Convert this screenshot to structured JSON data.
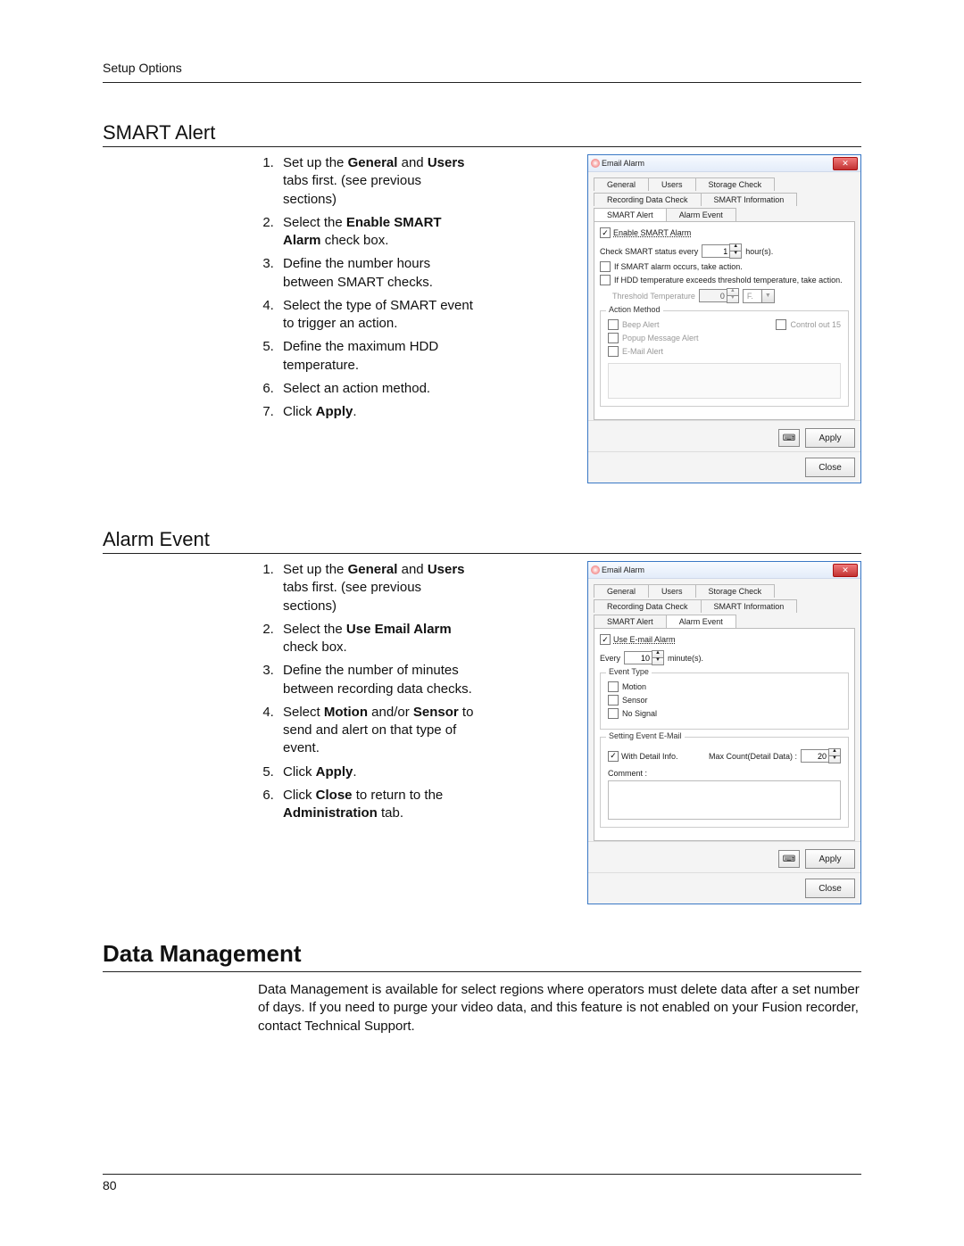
{
  "header": {
    "label": "Setup Options"
  },
  "footer": {
    "page_number": "80"
  },
  "sections": {
    "smart_alert": {
      "title": "SMART Alert",
      "steps": {
        "s1": {
          "pre": "Set up the ",
          "b1": "General",
          "mid": " and ",
          "b2": "Users",
          "post": " tabs first. (see previous sections)"
        },
        "s2": {
          "pre": "Select the ",
          "b1": "Enable SMART Alarm",
          "post": " check box."
        },
        "s3": "Define the number hours between SMART checks.",
        "s4": "Select the type of SMART event to trigger an action.",
        "s5": "Define the maximum HDD temperature.",
        "s6": "Select an action method.",
        "s7": {
          "pre": "Click ",
          "b1": "Apply",
          "post": "."
        }
      }
    },
    "alarm_event": {
      "title": "Alarm Event",
      "steps": {
        "s1": {
          "pre": "Set up the ",
          "b1": "General",
          "mid": " and ",
          "b2": "Users",
          "post": " tabs first. (see previous sections)"
        },
        "s2": {
          "pre": "Select the ",
          "b1": "Use Email Alarm",
          "post": " check box."
        },
        "s3": "Define the number of minutes between recording data checks.",
        "s4": {
          "pre": "Select ",
          "b1": "Motion",
          "mid": " and/or ",
          "b2": "Sensor",
          "post": " to send and alert on that type of event."
        },
        "s5": {
          "pre": "Click ",
          "b1": "Apply",
          "post": "."
        },
        "s6": {
          "pre": "Click ",
          "b1": "Close",
          "mid": " to return to the ",
          "b2": "Administration",
          "post": " tab."
        }
      }
    },
    "data_mgmt": {
      "title": "Data Management",
      "para": "Data Management is available for select regions where operators must delete data after a set number of days.  If you need to purge your video data, and this feature is not enabled on your Fusion recorder, contact Technical Support."
    }
  },
  "dialog_smart": {
    "title": "Email Alarm",
    "tabs": {
      "t1": "General",
      "t2": "Users",
      "t3": "Storage Check",
      "t4": "Recording Data Check",
      "t5": "SMART Information",
      "t6": "SMART Alert",
      "t7": "Alarm Event"
    },
    "enable_label": "Enable SMART Alarm",
    "check_every_pre": "Check SMART status every",
    "check_every_value": "1",
    "check_every_unit": "hour(s).",
    "if_alarm": "If SMART alarm occurs, take action.",
    "if_hdd": "If HDD temperature exceeds threshold temperature, take action.",
    "threshold_label": "Threshold Temperature",
    "threshold_value": "0",
    "threshold_unit": "F.",
    "action_method_legend": "Action Method",
    "beep": "Beep Alert",
    "popup": "Popup Message Alert",
    "email": "E-Mail Alert",
    "control_out": "Control out 15",
    "apply": "Apply",
    "close": "Close"
  },
  "dialog_alarm": {
    "title": "Email Alarm",
    "tabs": {
      "t1": "General",
      "t2": "Users",
      "t3": "Storage Check",
      "t4": "Recording Data Check",
      "t5": "SMART Information",
      "t6": "SMART Alert",
      "t7": "Alarm Event"
    },
    "use_label": "Use E-mail Alarm",
    "every_pre": "Every",
    "every_value": "10",
    "every_unit": "minute(s).",
    "event_type_legend": "Event Type",
    "motion": "Motion",
    "sensor": "Sensor",
    "nosignal": "No Signal",
    "setting_legend": "Setting Event E-Mail",
    "with_detail": "With Detail Info.",
    "max_count_label": "Max Count(Detail Data) :",
    "max_count_value": "20",
    "comment_label": "Comment :",
    "apply": "Apply",
    "close": "Close"
  }
}
